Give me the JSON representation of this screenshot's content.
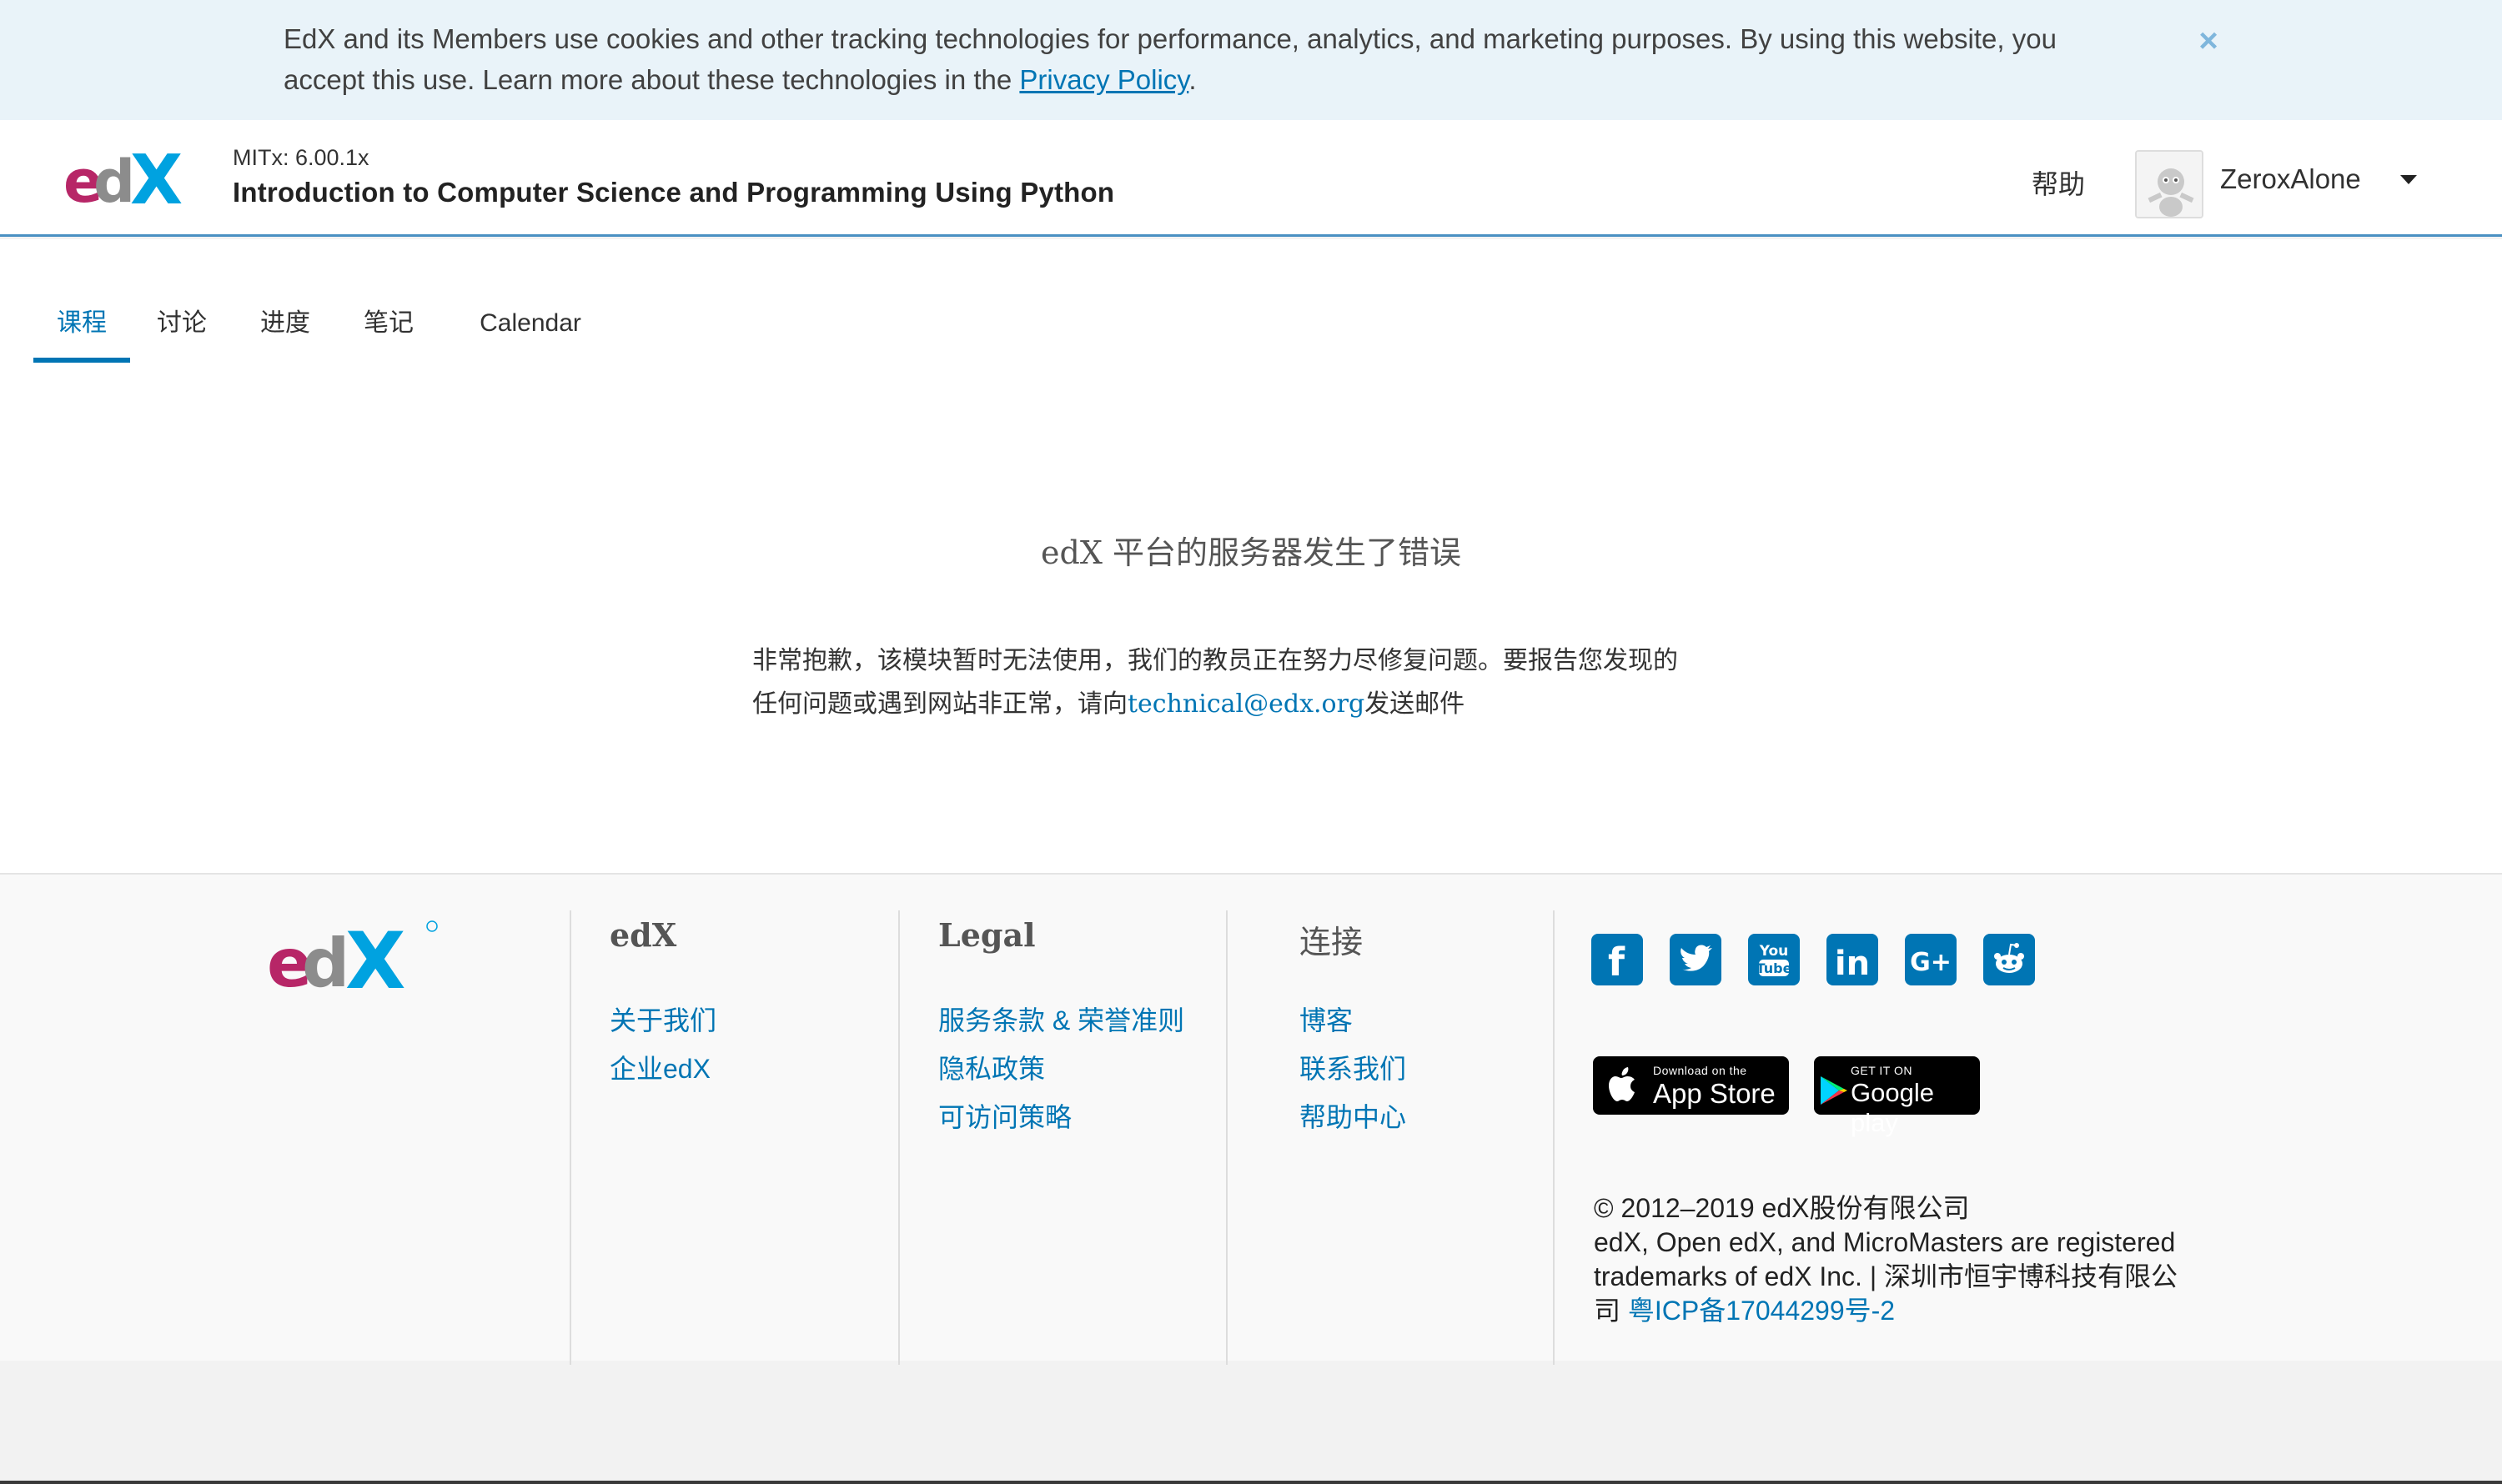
{
  "cookie_banner": {
    "text": "EdX and its Members use cookies and other tracking technologies for performance, analytics, and marketing purposes. By using this website, you accept this use. Learn more about these technologies in the ",
    "link": "Privacy Policy",
    "period": ".",
    "close": "×"
  },
  "header": {
    "logo": "edX",
    "course_org": "MITx: 6.00.1x",
    "course_title": "Introduction to Computer Science and Programming Using Python",
    "help": "帮助",
    "username": "ZeroxAlone"
  },
  "tabs": [
    {
      "label": "课程",
      "active": true
    },
    {
      "label": "讨论",
      "active": false
    },
    {
      "label": "进度",
      "active": false
    },
    {
      "label": "笔记",
      "active": false
    },
    {
      "label": "Calendar",
      "active": false
    }
  ],
  "error": {
    "title": "edX 平台的服务器发生了错误",
    "body_line1": "非常抱歉，该模块暂时无法使用，我们的教员正在努力尽修复问题。要报告您发现的",
    "body_line2_pre": "任何问题或遇到网站非正常，请向",
    "email": "technical@edx.org",
    "body_line2_post": "发送邮件"
  },
  "footer": {
    "logo": "edX",
    "col_edx": {
      "heading": "edX",
      "links": [
        "关于我们",
        "企业edX"
      ]
    },
    "col_legal": {
      "heading": "Legal",
      "links": [
        "服务条款 & 荣誉准则",
        "隐私政策",
        "可访问策略"
      ]
    },
    "col_connect": {
      "heading": "连接",
      "links": [
        "博客",
        "联系我们",
        "帮助中心"
      ]
    },
    "social_icons": [
      "facebook-icon",
      "twitter-icon",
      "youtube-icon",
      "linkedin-icon",
      "google-plus-icon",
      "reddit-icon"
    ],
    "app_store": {
      "small": "Download on the",
      "big": "App Store"
    },
    "google_play": {
      "small": "GET IT ON",
      "big": "Google play"
    },
    "copyright_line1": "© 2012–2019 edX股份有限公司",
    "copyright_line2": "edX, Open edX, and MicroMasters are registered trademarks of edX Inc. | 深圳市恒宇博科技有限公司 ",
    "icp": "粤ICP备17044299号-2"
  },
  "colors": {
    "accent": "#0075b4",
    "brand_pink": "#b72667",
    "brand_gray": "#8c8c8c",
    "brand_blue": "#00a2e0"
  }
}
